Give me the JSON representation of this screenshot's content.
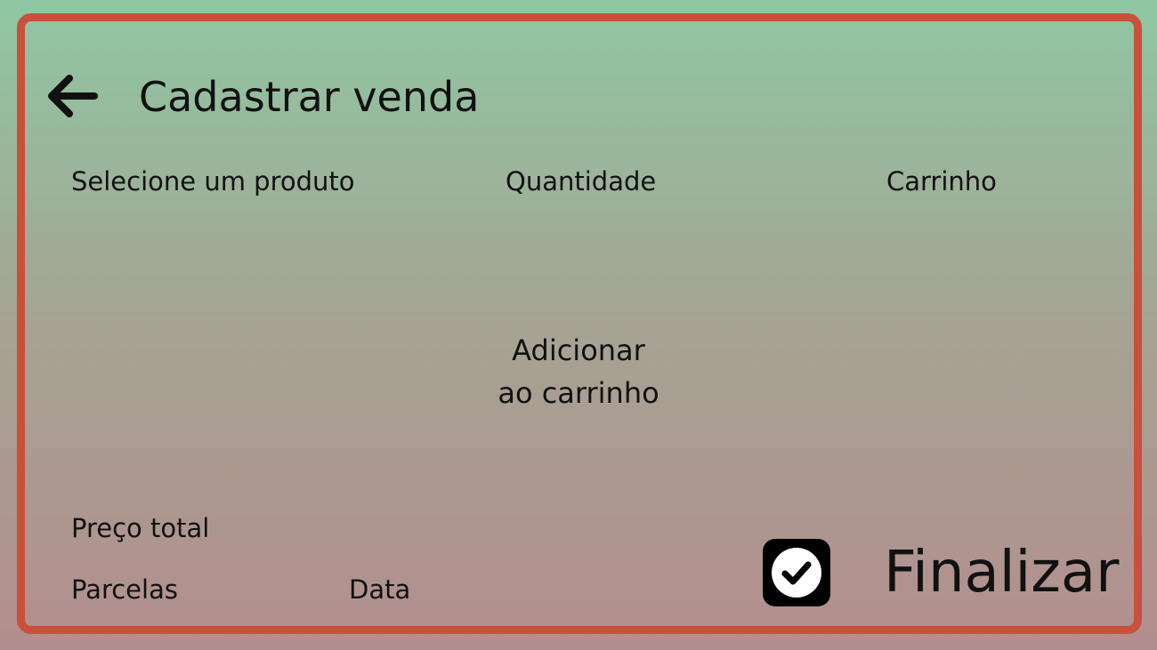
{
  "page": {
    "title": "Cadastrar venda"
  },
  "icons": {
    "back": "arrow-left-icon",
    "finalize": "check-square-icon"
  },
  "colors": {
    "frame_border": "#c9503b",
    "gradient_top": "#8fc7a3",
    "gradient_bottom": "#b38e8e",
    "text": "#111111"
  },
  "form": {
    "product_label": "Selecione um produto",
    "quantity_label": "Quantidade",
    "cart_label": "Carrinho",
    "add_to_cart_line1": "Adicionar",
    "add_to_cart_line2": "ao carrinho",
    "total_price_label": "Preço total",
    "installments_label": "Parcelas",
    "date_label": "Data"
  },
  "actions": {
    "finalize_label": "Finalizar"
  }
}
